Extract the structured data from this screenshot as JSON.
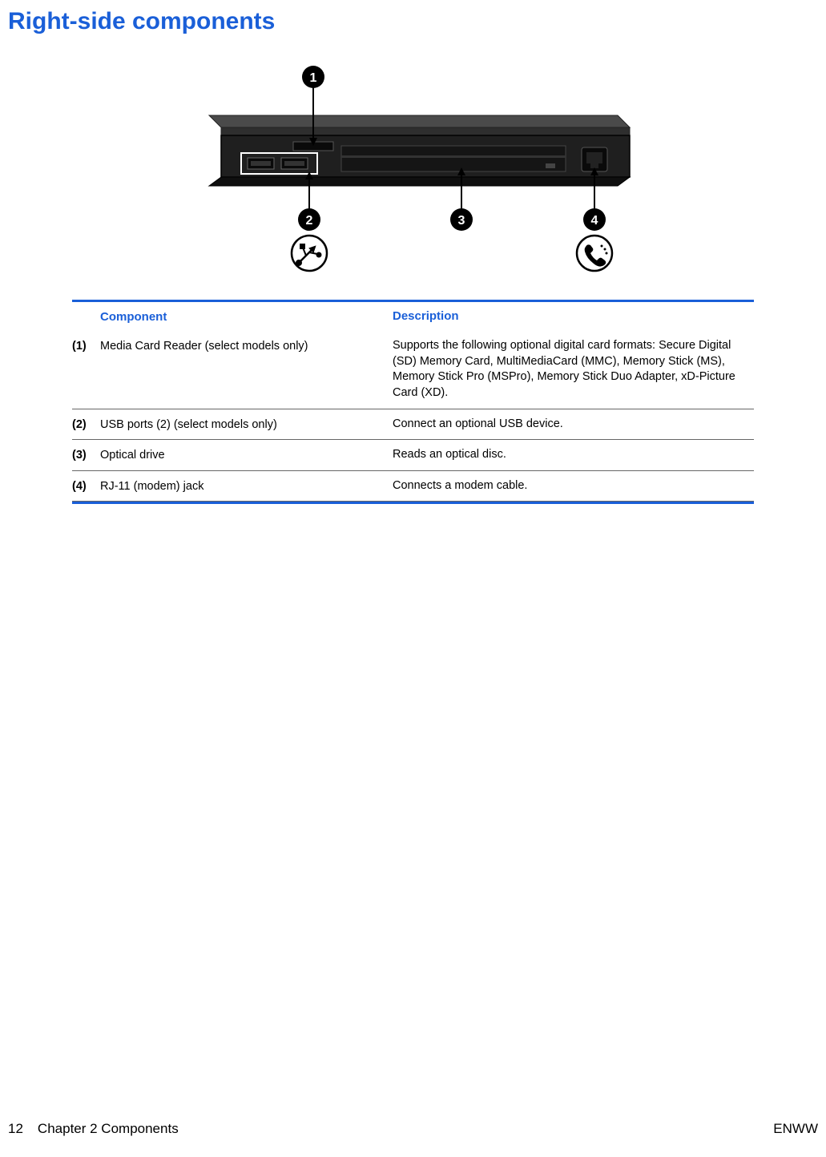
{
  "title": "Right-side components",
  "tableHeaders": {
    "component": "Component",
    "description": "Description"
  },
  "rows": [
    {
      "num": "(1)",
      "component": "Media Card Reader (select models only)",
      "description": "Supports the following optional digital card formats: Secure Digital (SD) Memory Card, MultiMediaCard (MMC), Memory Stick (MS), Memory Stick Pro (MSPro), Memory Stick Duo Adapter, xD-Picture Card (XD)."
    },
    {
      "num": "(2)",
      "component": "USB ports (2) (select models only)",
      "description": "Connect an optional USB device."
    },
    {
      "num": "(3)",
      "component": "Optical drive",
      "description": "Reads an optical disc."
    },
    {
      "num": "(4)",
      "component": "RJ-11 (modem) jack",
      "description": "Connects a modem cable."
    }
  ],
  "footer": {
    "pageNum": "12",
    "chapter": "Chapter 2   Components",
    "right": "ENWW"
  }
}
